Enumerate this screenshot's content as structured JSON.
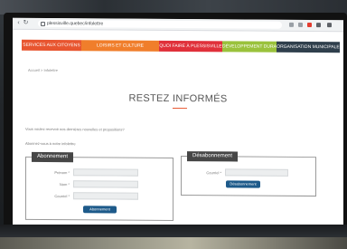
{
  "browser": {
    "url": "plessisville.quebec/infolettre"
  },
  "site_nav": [
    {
      "label": "SERVICES AUX CITOYENS",
      "color": "#e8552f"
    },
    {
      "label": "LOISIRS ET CULTURE",
      "color": "#f07e2b"
    },
    {
      "label": "QUOI FAIRE À PLESSISVILLE",
      "color": "#e0303a"
    },
    {
      "label": "DÉVELOPPEMENT DURABLE",
      "color": "#9ac23c"
    },
    {
      "label": "ORGANISATION MUNICIPALE",
      "color": "#2f3f4c"
    }
  ],
  "breadcrumb": "Accueil  >  Infolettre",
  "page": {
    "title": "RESTEZ INFORMÉS",
    "intro": "Vous voulez recevoir nos dernières nouvelles et propositions?",
    "subintro": "Abonnez-vous à notre infolettre"
  },
  "subscribe": {
    "legend": "Abonnement",
    "fields": [
      {
        "label": "Prénom *",
        "value": ""
      },
      {
        "label": "Nom *",
        "value": ""
      },
      {
        "label": "Courriel *",
        "value": ""
      }
    ],
    "button": "Abonnement"
  },
  "unsubscribe": {
    "legend": "Désabonnement",
    "fields": [
      {
        "label": "Courriel *",
        "value": ""
      }
    ],
    "button": "Désabonnement"
  },
  "colors": {
    "accent": "#e8552f",
    "button": "#1d5a8a",
    "legend": "#464646"
  }
}
